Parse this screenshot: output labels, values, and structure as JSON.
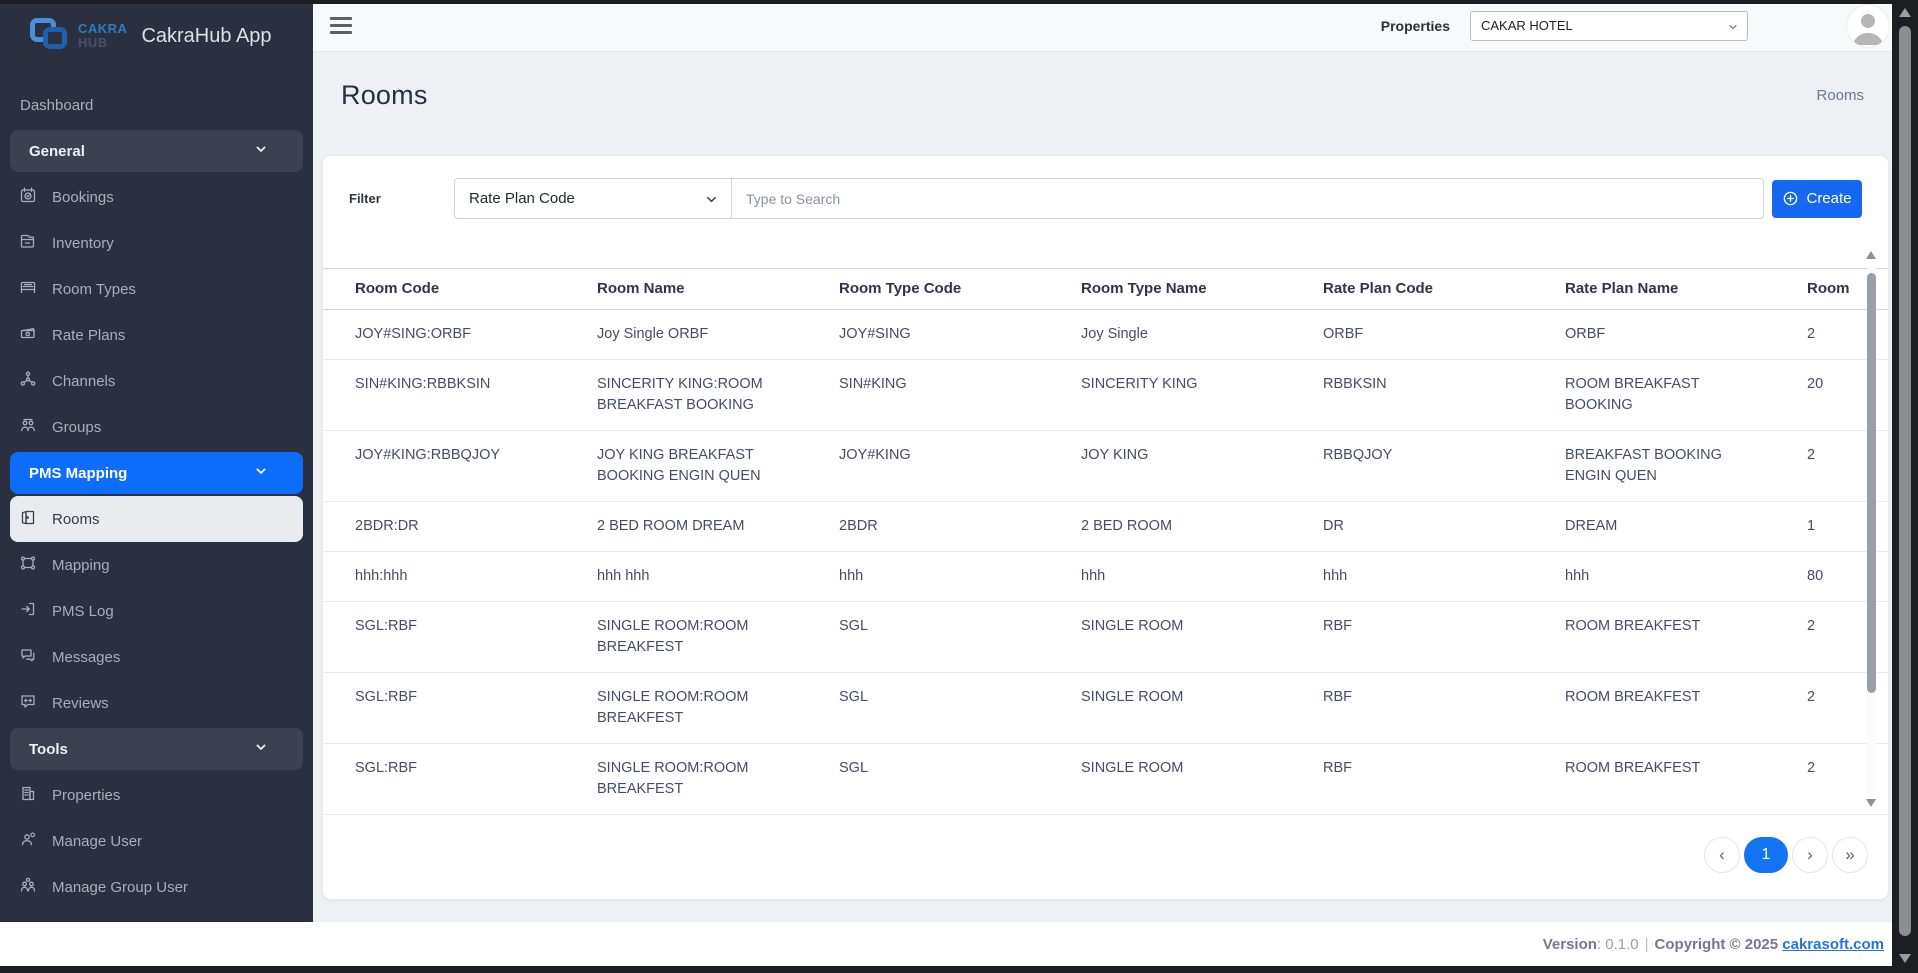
{
  "brand": {
    "logo_top": "CAKRA",
    "logo_bottom": "HUB",
    "app_title": "CakraHub App"
  },
  "topbar": {
    "properties_label": "Properties",
    "property_selected": "CAKAR HOTEL"
  },
  "sidebar": {
    "items": [
      {
        "label": "Dashboard",
        "type": "link"
      },
      {
        "label": "General",
        "type": "group",
        "icon": "chevron-down"
      },
      {
        "label": "Bookings",
        "type": "sublink",
        "icon": "calendar"
      },
      {
        "label": "Inventory",
        "type": "sublink",
        "icon": "archive-box"
      },
      {
        "label": "Room Types",
        "type": "sublink",
        "icon": "bed"
      },
      {
        "label": "Rate Plans",
        "type": "sublink",
        "icon": "cash"
      },
      {
        "label": "Channels",
        "type": "sublink",
        "icon": "share-network"
      },
      {
        "label": "Groups",
        "type": "sublink",
        "icon": "people"
      },
      {
        "label": "PMS Mapping",
        "type": "group-active",
        "icon": "chevron-down"
      },
      {
        "label": "Rooms",
        "type": "sublink-active",
        "icon": "door"
      },
      {
        "label": "Mapping",
        "type": "sublink",
        "icon": "command-nodes"
      },
      {
        "label": "PMS Log",
        "type": "sublink",
        "icon": "log-in"
      },
      {
        "label": "Messages",
        "type": "sublink",
        "icon": "chat"
      },
      {
        "label": "Reviews",
        "type": "sublink",
        "icon": "chat-stars"
      },
      {
        "label": "Tools",
        "type": "group",
        "icon": "chevron-down"
      },
      {
        "label": "Properties",
        "type": "sublink",
        "icon": "building"
      },
      {
        "label": "Manage User",
        "type": "sublink",
        "icon": "user-gear"
      },
      {
        "label": "Manage Group User",
        "type": "sublink",
        "icon": "users-gear"
      }
    ]
  },
  "page": {
    "title": "Rooms",
    "breadcrumb": "Rooms"
  },
  "filter": {
    "label": "Filter",
    "field_selected": "Rate Plan Code",
    "search_placeholder": "Type to Search",
    "create_label": "Create"
  },
  "table": {
    "columns": [
      "Room Code",
      "Room Name",
      "Room Type Code",
      "Room Type Name",
      "Rate Plan Code",
      "Rate Plan Name",
      "Room"
    ],
    "rows": [
      [
        "JOY#SING:ORBF",
        "Joy Single ORBF",
        "JOY#SING",
        "Joy Single",
        "ORBF",
        "ORBF",
        "2"
      ],
      [
        "SIN#KING:RBBKSIN",
        "SINCERITY KING:ROOM BREAKFAST BOOKING",
        "SIN#KING",
        "SINCERITY KING",
        "RBBKSIN",
        "ROOM BREAKFAST BOOKING",
        "20"
      ],
      [
        "JOY#KING:RBBQJOY",
        "JOY KING BREAKFAST BOOKING ENGIN QUEN",
        "JOY#KING",
        "JOY KING",
        "RBBQJOY",
        "BREAKFAST BOOKING ENGIN QUEN",
        "2"
      ],
      [
        "2BDR:DR",
        "2 BED ROOM DREAM",
        "2BDR",
        "2 BED ROOM",
        "DR",
        "DREAM",
        "1"
      ],
      [
        "hhh:hhh",
        "hhh hhh",
        "hhh",
        "hhh",
        "hhh",
        "hhh",
        "80"
      ],
      [
        "SGL:RBF",
        "SINGLE ROOM:ROOM BREAKFEST",
        "SGL",
        "SINGLE ROOM",
        "RBF",
        "ROOM BREAKFEST",
        "2"
      ],
      [
        "SGL:RBF",
        "SINGLE ROOM:ROOM BREAKFEST",
        "SGL",
        "SINGLE ROOM",
        "RBF",
        "ROOM BREAKFEST",
        "2"
      ],
      [
        "SGL:RBF",
        "SINGLE ROOM:ROOM BREAKFEST",
        "SGL",
        "SINGLE ROOM",
        "RBF",
        "ROOM BREAKFEST",
        "2"
      ]
    ]
  },
  "pagination": {
    "prev": "‹",
    "current": "1",
    "next": "›",
    "last": "»"
  },
  "footer": {
    "version_label": "Version",
    "version_value": ": 0.1.0",
    "separator": "|",
    "copyright": "Copyright © 2025 ",
    "link": "cakrasoft.com"
  },
  "icons": {
    "menu": "≡",
    "create_plus": "⊕",
    "chevron_down": "⌄",
    "avatar": "user-circle"
  },
  "colors": {
    "accent_blue": "#0d6efd",
    "sidebar_bg": "#2b3040",
    "sidebar_group_bg": "#3c4152",
    "active_item_bg": "#e9ebee",
    "create_button": "#1668f2",
    "link": "#2374e1",
    "page_bg": "#eef0f4"
  }
}
